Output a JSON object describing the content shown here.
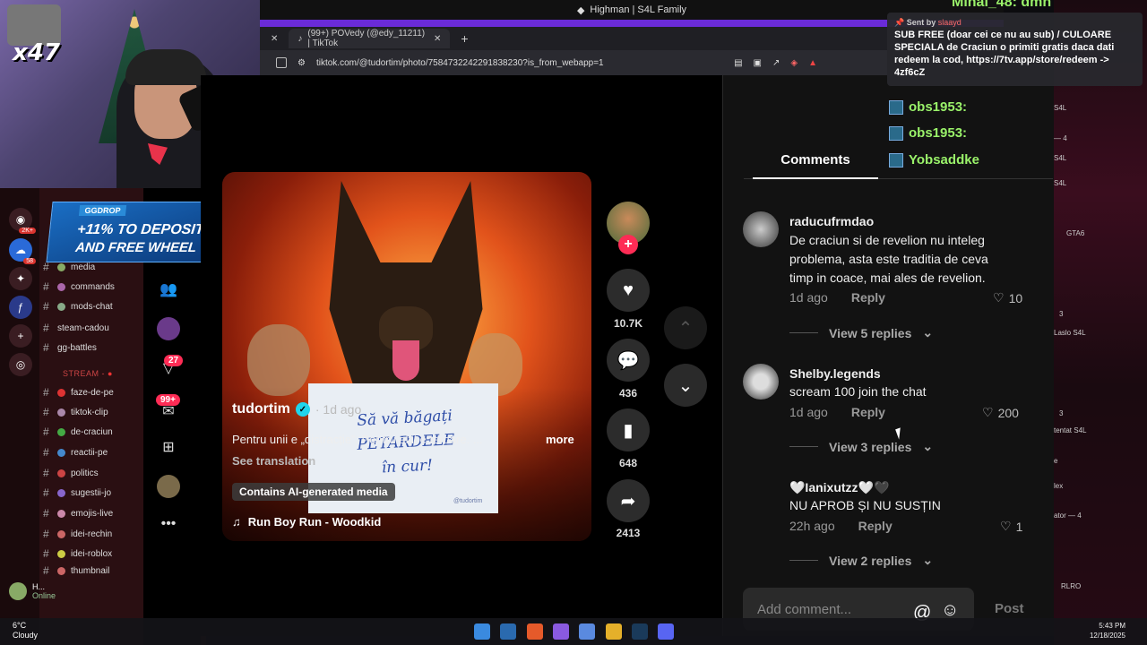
{
  "window": {
    "title": "Highman | S4L Family"
  },
  "browser": {
    "tab_title": "(99+) POVedy (@edy_11211) | TikTok",
    "url": "tiktok.com/@tudortim/photo/7584732242291838230?is_from_webapp=1"
  },
  "webcam": {
    "multiplier": "x47"
  },
  "discord": {
    "promo": {
      "badge": "GGDROP",
      "line1": "+11% TO DEPOSIT",
      "line2": "AND FREE WHEEL"
    },
    "server_badges": [
      "2K+",
      "58"
    ],
    "channels": [
      "media",
      "commands",
      "mods-chat",
      "steam-cadou",
      "gg-battles"
    ],
    "stream_header": "STREAM -",
    "stream_channels": [
      "faze-de-pe",
      "tiktok-clip",
      "de-craciun",
      "reactii-pe",
      "politics",
      "sugestii-jo",
      "emojis-live",
      "idei-rechin",
      "idei-roblox",
      "thumbnail"
    ],
    "user": {
      "name": "H...",
      "status": "Online"
    },
    "weather": {
      "temp": "6°C",
      "desc": "Cloudy"
    }
  },
  "tiktok_nav": {
    "badge_inbox": "27",
    "badge_messages": "99+"
  },
  "post": {
    "author": "tudortim",
    "when": "· 1d ago",
    "caption": "Pentru unii e „distracție”. Pentru alții e teroare. ...",
    "more": "more",
    "see_translation": "See translation",
    "ai_tag": "Contains AI-generated media",
    "music": "Run Boy Run - Woodkid",
    "sign_lines": [
      "Să vă băgați",
      "PETARDELE",
      "în cur!"
    ],
    "sign_watermark": "@tudortim",
    "likes": "10.7K",
    "comments": "436",
    "saves": "648",
    "shares": "2413"
  },
  "comments_panel": {
    "tab": "Comments",
    "items": [
      {
        "user": "raducufrmdao",
        "text": "De craciun si de revelion nu inteleg problema, asta este traditia de ceva timp in coace, mai ales de revelion.",
        "time": "1d ago",
        "reply": "Reply",
        "likes": "10",
        "view_replies": "View 5 replies"
      },
      {
        "user": "Shelby.legends",
        "text": "scream 100 join the chat",
        "time": "1d ago",
        "reply": "Reply",
        "likes": "200",
        "view_replies": "View 3 replies"
      },
      {
        "user": "🤍Ianixutzz🤍🖤",
        "text": "NU APROB ȘI NU SUSȚIN",
        "time": "22h ago",
        "reply": "Reply",
        "likes": "1",
        "view_replies": "View 2 replies"
      }
    ],
    "add_placeholder": "Add comment...",
    "post_label": "Post"
  },
  "chat_overlay": {
    "top_name": "Mihai_48: dmn",
    "sent_by_label": "Sent by",
    "sent_by_user": "slaayd",
    "notice": "SUB FREE (doar cei ce nu au sub) / CULOARE SPECIALA de Craciun o primiti gratis daca dati redeem la cod, https://7tv.app/store/redeem -> 4zf6cZ",
    "obs_lines": [
      "obs1953:",
      "obs1953:",
      "obs1953:",
      "Yobsaddke"
    ],
    "side_lines": [
      "S4L",
      "— 4",
      "S4L",
      "S4L",
      "GTA6",
      "3",
      "Laslo S4L",
      "3",
      "tentat S4L",
      "e",
      "lex",
      "ator — 4",
      "RLRO"
    ]
  },
  "taskbar": {
    "time": "5:43 PM",
    "date": "12/18/2025"
  },
  "colors": {
    "accent": "#6a2bd8",
    "tiktok_red": "#fe2c55",
    "verified": "#20d5ec",
    "obs_green": "#9af26a"
  }
}
